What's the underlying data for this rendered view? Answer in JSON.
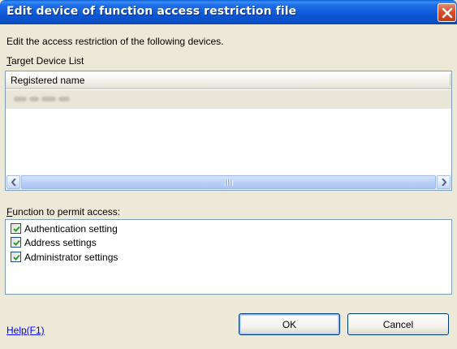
{
  "window": {
    "title": "Edit device of function access restriction file"
  },
  "instruction": "Edit the access restriction of the following devices.",
  "target_list": {
    "label_prefix": "T",
    "label_rest": "arget Device List",
    "column_header": "Registered name",
    "rows": [
      {
        "name_redacted": true
      }
    ]
  },
  "functions": {
    "label_prefix": "F",
    "label_rest": "unction to permit access:",
    "items": [
      {
        "label": "Authentication setting",
        "checked": true
      },
      {
        "label": "Address settings",
        "checked": true
      },
      {
        "label": "Administrator settings",
        "checked": true
      }
    ]
  },
  "footer": {
    "help_link": "Help(F1)",
    "ok_label": "OK",
    "cancel_label": "Cancel"
  },
  "colors": {
    "titlebar": "#0d58d6",
    "dialog_bg": "#ece9d8",
    "link": "#0000ff",
    "checkmark": "#21a121"
  }
}
